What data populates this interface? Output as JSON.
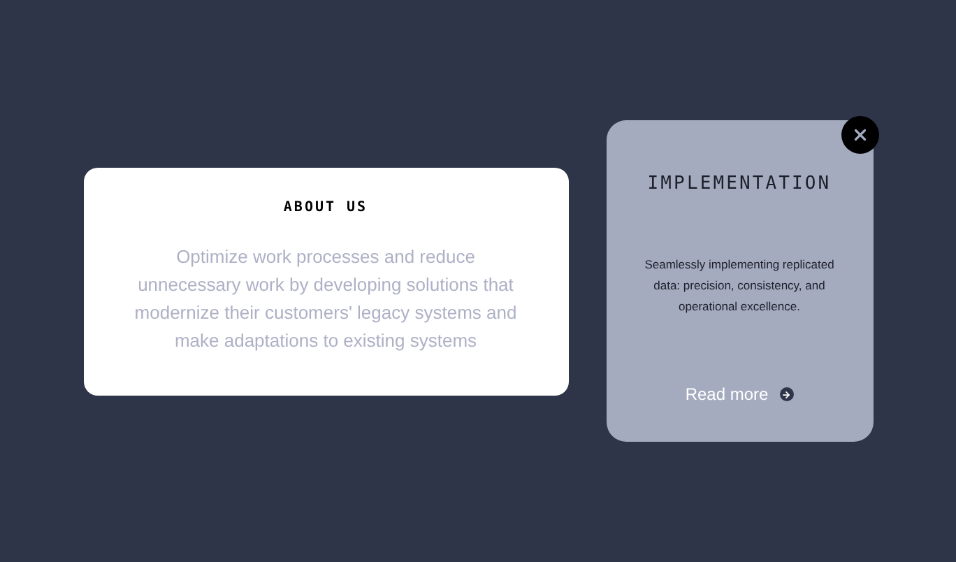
{
  "about_card": {
    "title": "ABOUT US",
    "body": "Optimize work processes and reduce unnecessary work by developing solutions that modernize their customers' legacy systems and make adaptations to existing systems"
  },
  "feature_card": {
    "title": "IMPLEMENTATION",
    "body": "Seamlessly implementing replicated data: precision, consistency, and operational excellence.",
    "link": "Read more"
  }
}
